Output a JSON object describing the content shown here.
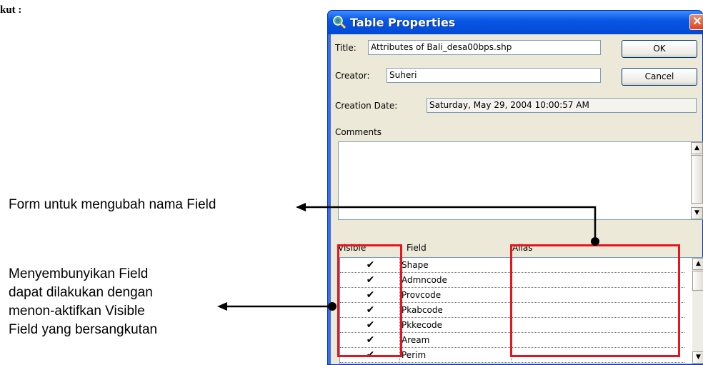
{
  "document": {
    "fragment": "kut :",
    "callout_rename": "Form untuk mengubah nama Field",
    "callout_hide": "Menyembunyikan Field\ndapat dilakukan dengan\nmenon-aktifkan Visible\nField yang bersangkutan"
  },
  "window": {
    "title": "Table Properties",
    "close_glyph": "✕",
    "title_icon": "magnifier-globe-icon"
  },
  "form": {
    "title_label": "Title:",
    "title_value": "Attributes of Bali_desa00bps.shp",
    "creator_label": "Creator:",
    "creator_value": "Suheri",
    "date_label": "Creation Date:",
    "date_value": "Saturday, May 29, 2004 10:00:57 AM",
    "comments_label": "Comments",
    "ok_label": "OK",
    "cancel_label": "Cancel"
  },
  "grid": {
    "headers": [
      "Visible",
      "Field",
      "Alias"
    ],
    "rows": [
      {
        "visible": "✔",
        "field": "Shape",
        "alias": ""
      },
      {
        "visible": "✔",
        "field": "Admncode",
        "alias": ""
      },
      {
        "visible": "✔",
        "field": "Provcode",
        "alias": ""
      },
      {
        "visible": "✔",
        "field": "Pkabcode",
        "alias": ""
      },
      {
        "visible": "✔",
        "field": "Pkkecode",
        "alias": ""
      },
      {
        "visible": "✔",
        "field": "Aream",
        "alias": ""
      },
      {
        "visible": "✔",
        "field": "Perim",
        "alias": ""
      }
    ]
  },
  "scroll_glyphs": {
    "up": "▲",
    "down": "▼"
  },
  "colors": {
    "highlight": "#e8141d",
    "titlebar": "#0a57e5"
  }
}
